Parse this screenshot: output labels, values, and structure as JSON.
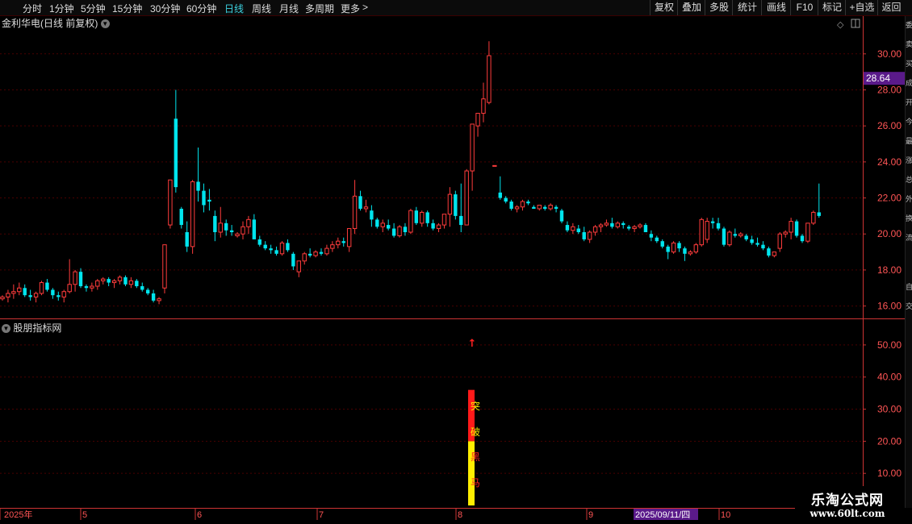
{
  "toolbar": {
    "periods": [
      "分时",
      "1分钟",
      "5分钟",
      "15分钟",
      "30分钟",
      "60分钟",
      "日线",
      "周线",
      "月线",
      "多周期",
      "更多"
    ],
    "active_period": "日线",
    "tools": [
      "复权",
      "叠加",
      "多股",
      "统计",
      "画线",
      "F10",
      "标记",
      "+自选",
      "返回"
    ]
  },
  "main_panel": {
    "title": "金利华电(日线 前复权)",
    "price_tag": "28.64",
    "y_ticks": [
      "30.00",
      "28.00",
      "26.00",
      "24.00",
      "22.00",
      "20.00",
      "18.00",
      "16.00"
    ],
    "y_range": [
      15.4,
      31.2
    ]
  },
  "sub_panel": {
    "title": "股朋指标网",
    "y_ticks": [
      "50.00",
      "40.00",
      "30.00",
      "20.00",
      "10.00"
    ],
    "y_range": [
      0,
      56
    ],
    "signal_bar": {
      "red_from": 20,
      "red_to": 36,
      "yellow_from": 0,
      "yellow_to": 20
    },
    "signal_chars": [
      "突",
      "破",
      "黑",
      "马"
    ],
    "arrow": "↑"
  },
  "x_axis": {
    "labels": [
      "2025年",
      "5",
      "6",
      "7",
      "8",
      "9",
      "2025/09/11/四",
      "10"
    ],
    "highlighted_label": "2025/09/11/四"
  },
  "sidebar_chars": [
    "委",
    "卖",
    "买",
    "成",
    "开",
    "今",
    "最",
    "涨",
    "总",
    "外",
    "换",
    "流",
    "自",
    "交"
  ],
  "watermark": {
    "title": "乐淘公式网",
    "url": "www.60lt.com"
  },
  "colors": {
    "up": "#ff3c3c",
    "down": "#00e5ee",
    "grid": "#4a0000",
    "axis": "#c33",
    "signal_red": "#ff1a1a",
    "signal_yellow": "#ffee00",
    "price_tag_bg": "#5a1a8a",
    "date_tag_bg": "#5a1a8a"
  },
  "chart_data": {
    "type": "candlestick",
    "title": "金利华电(日线 前复权)",
    "unit_series": "price (CNY)",
    "candles": [
      [
        16.4,
        16.6,
        16.3,
        16.5
      ],
      [
        16.5,
        16.9,
        16.2,
        16.7
      ],
      [
        16.7,
        17.2,
        16.4,
        16.8
      ],
      [
        16.8,
        17.3,
        16.6,
        17.0
      ],
      [
        17.0,
        17.2,
        16.5,
        16.6
      ],
      [
        16.6,
        16.9,
        16.3,
        16.5
      ],
      [
        16.5,
        16.8,
        16.2,
        16.7
      ],
      [
        16.7,
        17.4,
        16.6,
        17.3
      ],
      [
        17.3,
        17.5,
        16.8,
        16.9
      ],
      [
        16.9,
        17.0,
        16.4,
        16.6
      ],
      [
        16.6,
        16.8,
        16.3,
        16.5
      ],
      [
        16.5,
        16.9,
        16.2,
        16.8
      ],
      [
        16.8,
        18.6,
        16.7,
        17.2
      ],
      [
        17.2,
        18.0,
        16.8,
        17.9
      ],
      [
        17.9,
        18.1,
        17.0,
        17.1
      ],
      [
        17.1,
        17.2,
        16.8,
        17.0
      ],
      [
        17.0,
        17.3,
        16.8,
        17.1
      ],
      [
        17.1,
        17.5,
        16.9,
        17.4
      ],
      [
        17.4,
        17.6,
        17.2,
        17.5
      ],
      [
        17.5,
        17.6,
        17.1,
        17.3
      ],
      [
        17.3,
        17.5,
        17.0,
        17.4
      ],
      [
        17.4,
        17.7,
        17.2,
        17.6
      ],
      [
        17.6,
        17.7,
        17.1,
        17.2
      ],
      [
        17.2,
        17.6,
        17.0,
        17.4
      ],
      [
        17.4,
        17.5,
        17.0,
        17.1
      ],
      [
        17.1,
        17.3,
        16.8,
        16.9
      ],
      [
        16.9,
        17.0,
        16.6,
        16.7
      ],
      [
        16.7,
        16.9,
        16.2,
        16.3
      ],
      [
        16.3,
        16.5,
        16.1,
        16.4
      ],
      [
        17.0,
        18.5,
        16.7,
        19.4
      ],
      [
        20.5,
        23.0,
        20.3,
        23.0
      ],
      [
        26.4,
        28.0,
        22.3,
        22.6
      ],
      [
        21.4,
        21.5,
        20.3,
        20.5
      ],
      [
        20.1,
        20.7,
        19.0,
        19.3
      ],
      [
        19.3,
        23.0,
        18.9,
        22.9
      ],
      [
        22.9,
        24.8,
        21.8,
        22.4
      ],
      [
        22.4,
        22.8,
        21.2,
        21.6
      ],
      [
        21.9,
        22.5,
        21.3,
        21.8
      ],
      [
        21.0,
        21.3,
        19.6,
        20.1
      ],
      [
        20.1,
        21.5,
        19.8,
        20.6
      ],
      [
        20.6,
        20.8,
        19.9,
        20.2
      ],
      [
        20.2,
        20.5,
        19.9,
        20.1
      ],
      [
        19.9,
        20.1,
        19.8,
        20.0
      ],
      [
        20.0,
        20.7,
        19.7,
        20.4
      ],
      [
        20.4,
        21.0,
        20.0,
        20.8
      ],
      [
        20.8,
        21.1,
        19.9,
        19.7
      ],
      [
        19.7,
        19.9,
        19.3,
        19.4
      ],
      [
        19.4,
        19.6,
        19.1,
        19.2
      ],
      [
        19.2,
        19.4,
        18.9,
        19.1
      ],
      [
        19.1,
        19.3,
        18.8,
        18.9
      ],
      [
        18.9,
        19.6,
        18.8,
        19.5
      ],
      [
        19.5,
        19.7,
        19.0,
        19.1
      ],
      [
        18.9,
        19.0,
        18.0,
        18.2
      ],
      [
        17.9,
        17.9,
        17.6,
        18.5
      ],
      [
        18.5,
        19.0,
        18.3,
        18.9
      ],
      [
        18.9,
        19.2,
        18.7,
        18.8
      ],
      [
        18.8,
        19.1,
        18.7,
        19.0
      ],
      [
        19.0,
        19.2,
        18.8,
        18.9
      ],
      [
        18.9,
        19.4,
        18.8,
        19.2
      ],
      [
        19.2,
        19.6,
        19.0,
        19.4
      ],
      [
        19.4,
        19.8,
        19.2,
        19.6
      ],
      [
        19.6,
        19.8,
        19.3,
        19.5
      ],
      [
        19.3,
        19.4,
        19.0,
        20.3
      ],
      [
        20.3,
        23.0,
        20.0,
        22.1
      ],
      [
        22.1,
        22.4,
        21.3,
        21.4
      ],
      [
        21.4,
        21.9,
        21.2,
        21.5
      ],
      [
        21.3,
        21.6,
        20.4,
        20.8
      ],
      [
        20.8,
        20.9,
        20.3,
        20.4
      ],
      [
        20.4,
        20.8,
        20.1,
        20.6
      ],
      [
        20.5,
        20.8,
        20.2,
        20.3
      ],
      [
        20.3,
        20.6,
        19.8,
        19.9
      ],
      [
        19.9,
        20.5,
        19.8,
        20.4
      ],
      [
        20.4,
        20.6,
        19.9,
        20.1
      ],
      [
        20.1,
        21.4,
        20.0,
        21.3
      ],
      [
        21.3,
        21.5,
        20.5,
        20.6
      ],
      [
        20.6,
        21.3,
        20.4,
        21.2
      ],
      [
        21.2,
        21.3,
        20.4,
        20.6
      ],
      [
        20.6,
        20.8,
        20.2,
        20.3
      ],
      [
        20.3,
        20.6,
        20.1,
        20.5
      ],
      [
        20.5,
        21.1,
        20.3,
        21.1
      ],
      [
        21.1,
        22.6,
        20.4,
        22.2
      ],
      [
        22.2,
        22.4,
        20.8,
        21.0
      ],
      [
        21.0,
        22.8,
        20.1,
        20.5
      ],
      [
        20.5,
        23.6,
        20.8,
        23.5
      ],
      [
        23.5,
        26.1,
        22.4,
        26.1
      ],
      [
        26.0,
        26.0,
        25.4,
        26.7
      ],
      [
        26.7,
        28.4,
        26.2,
        27.5
      ],
      [
        27.3,
        30.7,
        27.2,
        29.9
      ],
      [
        23.8,
        23.8,
        23.8,
        23.8
      ],
      [
        22.3,
        23.2,
        21.9,
        22.0
      ],
      [
        22.0,
        22.1,
        21.7,
        21.8
      ],
      [
        21.8,
        21.9,
        21.3,
        21.4
      ],
      [
        21.4,
        21.6,
        21.2,
        21.5
      ],
      [
        21.5,
        21.9,
        21.3,
        21.8
      ],
      [
        21.8,
        21.9,
        21.6,
        21.7
      ],
      [
        21.5,
        21.6,
        21.4,
        21.4
      ],
      [
        21.4,
        21.6,
        21.3,
        21.6
      ],
      [
        21.5,
        21.6,
        21.3,
        21.4
      ],
      [
        21.4,
        21.7,
        21.3,
        21.6
      ],
      [
        21.5,
        21.6,
        21.2,
        21.4
      ],
      [
        21.3,
        21.4,
        20.6,
        20.7
      ],
      [
        20.5,
        20.7,
        20.1,
        20.2
      ],
      [
        20.2,
        20.6,
        20.0,
        20.4
      ],
      [
        20.3,
        20.5,
        20.0,
        20.1
      ],
      [
        20.1,
        20.4,
        19.6,
        19.7
      ],
      [
        19.7,
        20.2,
        19.5,
        20.1
      ],
      [
        20.1,
        20.5,
        19.9,
        20.4
      ],
      [
        20.4,
        20.6,
        20.1,
        20.5
      ],
      [
        20.5,
        20.8,
        20.4,
        20.6
      ],
      [
        20.6,
        20.9,
        20.3,
        20.4
      ],
      [
        20.4,
        20.7,
        20.3,
        20.6
      ],
      [
        20.6,
        20.7,
        20.3,
        20.5
      ],
      [
        20.4,
        20.5,
        20.2,
        20.3
      ],
      [
        20.3,
        20.5,
        20.1,
        20.4
      ],
      [
        20.4,
        20.6,
        20.3,
        20.5
      ],
      [
        20.5,
        20.6,
        20.1,
        20.1
      ],
      [
        20.0,
        20.2,
        19.6,
        19.8
      ],
      [
        19.8,
        19.9,
        19.5,
        19.6
      ],
      [
        19.6,
        19.7,
        19.2,
        19.3
      ],
      [
        19.3,
        19.4,
        18.6,
        19.0
      ],
      [
        19.0,
        19.6,
        18.9,
        19.5
      ],
      [
        19.5,
        19.6,
        19.0,
        19.2
      ],
      [
        19.2,
        19.3,
        18.5,
        18.9
      ],
      [
        18.9,
        19.1,
        18.8,
        19.0
      ],
      [
        19.0,
        19.5,
        18.9,
        19.4
      ],
      [
        19.4,
        20.9,
        19.3,
        20.8
      ],
      [
        19.7,
        20.9,
        19.5,
        20.7
      ],
      [
        20.7,
        20.9,
        20.3,
        20.6
      ],
      [
        20.6,
        20.9,
        20.2,
        20.3
      ],
      [
        20.3,
        20.4,
        19.3,
        19.4
      ],
      [
        19.4,
        20.2,
        19.3,
        20.1
      ],
      [
        20.0,
        20.3,
        19.8,
        19.9
      ],
      [
        19.9,
        20.1,
        19.8,
        20.0
      ],
      [
        19.9,
        20.0,
        19.6,
        19.7
      ],
      [
        19.7,
        19.9,
        19.4,
        19.5
      ],
      [
        19.5,
        19.8,
        19.3,
        19.4
      ],
      [
        19.4,
        19.6,
        19.1,
        19.2
      ],
      [
        19.2,
        19.3,
        18.7,
        18.8
      ],
      [
        18.8,
        19.0,
        18.7,
        19.0
      ],
      [
        19.2,
        20.1,
        19.0,
        20.0
      ],
      [
        20.0,
        20.2,
        19.8,
        20.1
      ],
      [
        20.1,
        20.9,
        19.7,
        20.7
      ],
      [
        20.7,
        20.8,
        19.8,
        19.9
      ],
      [
        19.9,
        20.0,
        19.5,
        19.6
      ],
      [
        19.6,
        20.6,
        19.5,
        20.6
      ],
      [
        20.6,
        21.3,
        20.5,
        21.2
      ],
      [
        21.2,
        22.8,
        20.9,
        21.0
      ]
    ],
    "x_labels": [
      "2025年",
      "5",
      "6",
      "7",
      "8",
      "9",
      "10"
    ],
    "y_ticks": [
      30,
      28,
      26,
      24,
      22,
      20,
      18,
      16
    ],
    "current_price": 28.64
  }
}
